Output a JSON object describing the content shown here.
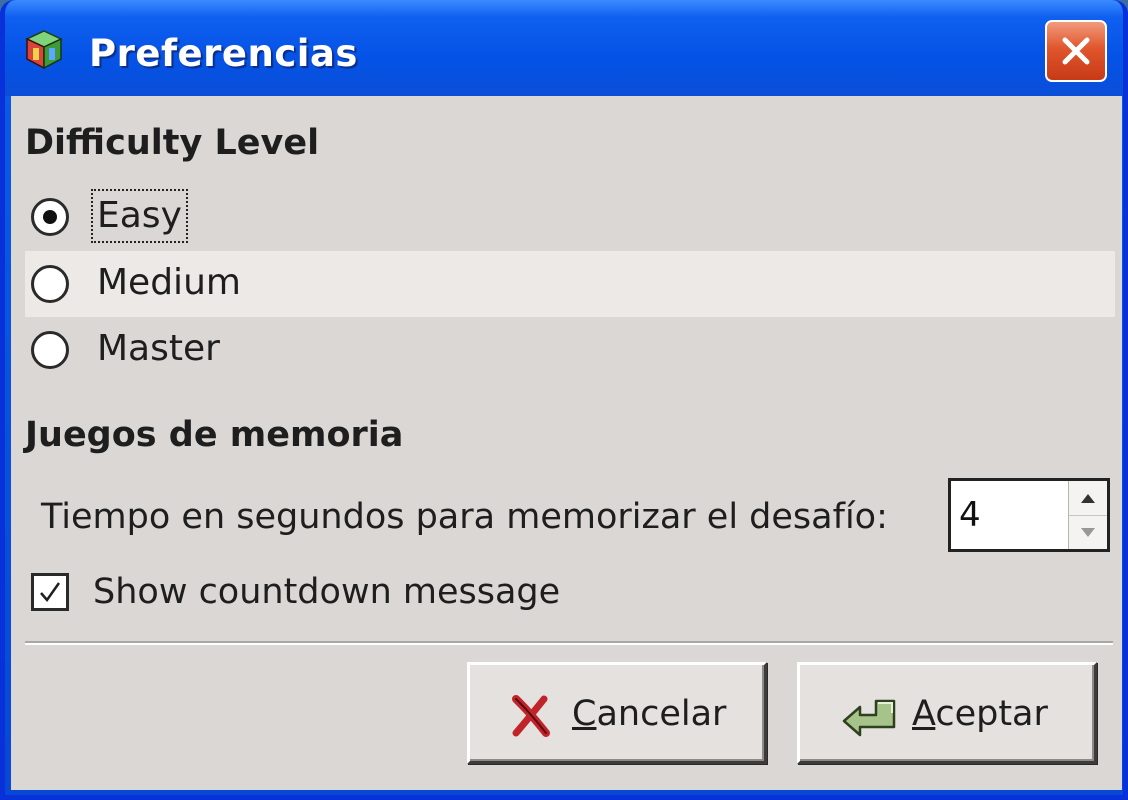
{
  "window": {
    "title": "Preferencias"
  },
  "difficulty": {
    "heading": "Difficulty Level",
    "options": [
      {
        "label": "Easy",
        "selected": true
      },
      {
        "label": "Medium",
        "selected": false
      },
      {
        "label": "Master",
        "selected": false
      }
    ]
  },
  "memory": {
    "heading": "Juegos de memoria",
    "time_label": "Tiempo en segundos para memorizar el desafío:",
    "time_value": "4",
    "countdown_label": "Show countdown message",
    "countdown_checked": true
  },
  "buttons": {
    "cancel_mnemonic": "C",
    "cancel_rest": "ancelar",
    "ok_mnemonic": "A",
    "ok_rest": "ceptar"
  },
  "icons": {
    "app": "gift-cube-icon",
    "close": "close-icon",
    "cancel": "red-x-icon",
    "ok": "enter-arrow-icon",
    "spin_up": "arrow-up-icon",
    "spin_down": "arrow-down-icon",
    "check": "checkmark-icon"
  },
  "colors": {
    "titlebar": "#0553e6",
    "client_bg": "#dad7d4",
    "close_btn": "#e0562c",
    "hover_row": "#ece9e7"
  }
}
